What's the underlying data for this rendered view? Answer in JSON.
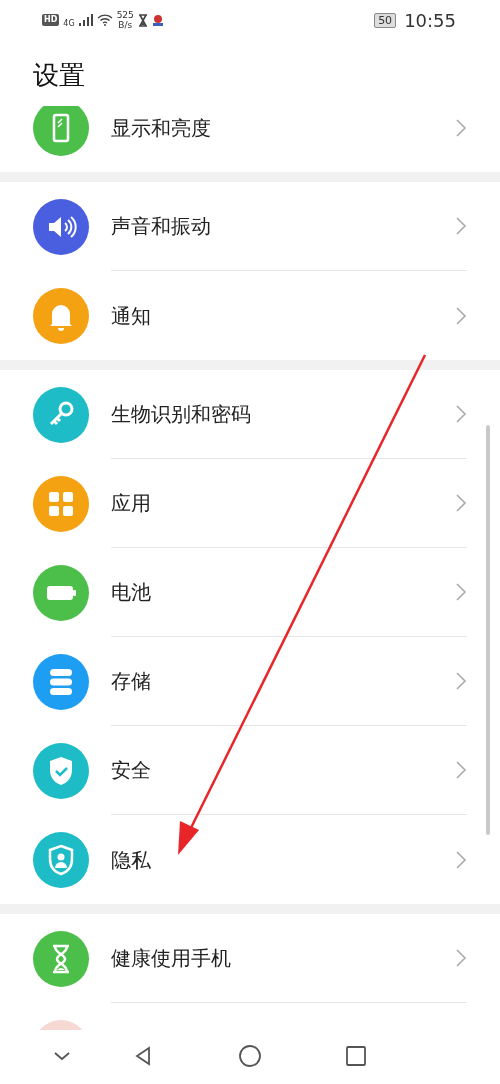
{
  "status_bar": {
    "left": [
      "HD",
      "4G"
    ],
    "speed": [
      "525",
      "B/s"
    ],
    "battery": "50",
    "time": "10:55"
  },
  "title": "设置",
  "groups": [
    {
      "items": [
        {
          "label": "显示和亮度",
          "color": "#4cbf4a"
        }
      ]
    },
    {
      "items": [
        {
          "label": "声音和振动",
          "color": "#4a5ee0"
        },
        {
          "label": "通知",
          "color": "#f5a212"
        }
      ]
    },
    {
      "items": [
        {
          "label": "生物识别和密码",
          "color": "#1dbcc6"
        },
        {
          "label": "应用",
          "color": "#f5a212"
        },
        {
          "label": "电池",
          "color": "#4cbf4a"
        },
        {
          "label": "存储",
          "color": "#1e9ef2"
        },
        {
          "label": "安全",
          "color": "#1dbcc6"
        },
        {
          "label": "隐私",
          "color": "#1dbcc6"
        }
      ]
    },
    {
      "items": [
        {
          "label": "健康使用手机",
          "color": "#4cbf4a"
        },
        {
          "color": "#f7d9d3"
        }
      ]
    }
  ],
  "annotation": {
    "kind": "arrow"
  }
}
